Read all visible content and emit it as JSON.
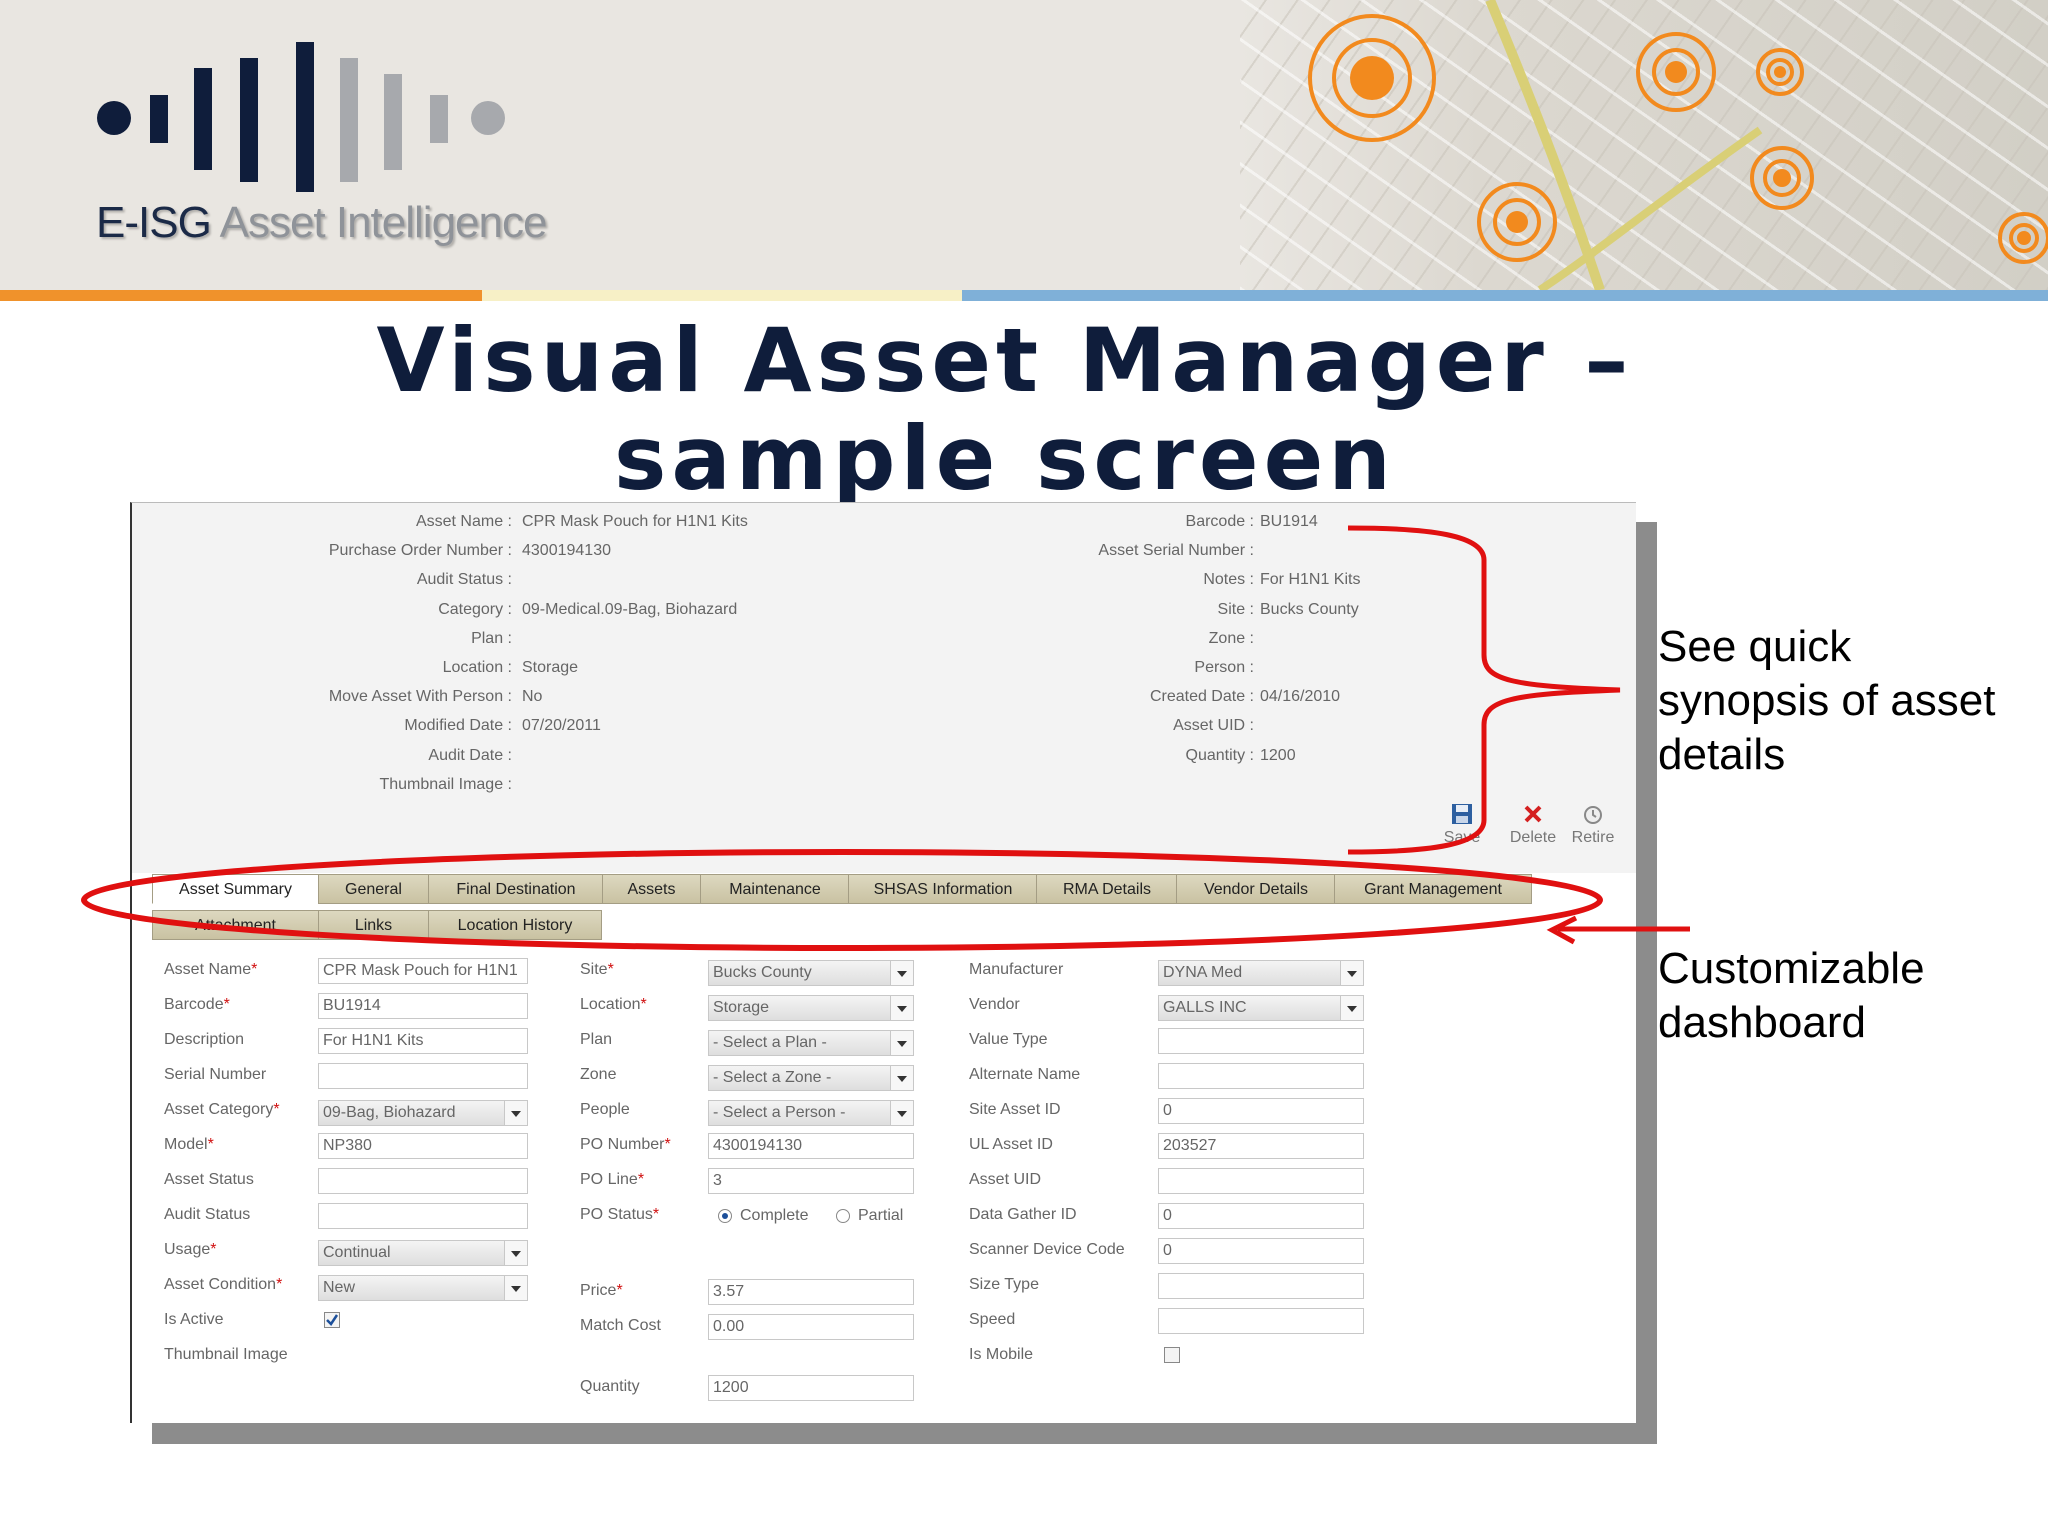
{
  "banner": {
    "logo_dark": "E-ISG",
    "logo_light": " Asset Intelligence"
  },
  "slide_title": "Visual Asset Manager – sample screen",
  "summary": {
    "left": [
      {
        "label": "Asset Name :",
        "value": "CPR Mask Pouch for H1N1 Kits"
      },
      {
        "label": "Purchase Order Number :",
        "value": "4300194130"
      },
      {
        "label": "Audit Status :",
        "value": ""
      },
      {
        "label": "Category :",
        "value": "09-Medical.09-Bag, Biohazard"
      },
      {
        "label": "Plan :",
        "value": ""
      },
      {
        "label": "Location :",
        "value": "Storage"
      },
      {
        "label": "Move Asset With Person :",
        "value": "No"
      },
      {
        "label": "Modified Date :",
        "value": "07/20/2011"
      },
      {
        "label": "Audit Date :",
        "value": ""
      },
      {
        "label": "Thumbnail Image :",
        "value": ""
      }
    ],
    "right": [
      {
        "label": "Barcode :",
        "value": "BU1914"
      },
      {
        "label": "Asset Serial Number :",
        "value": ""
      },
      {
        "label": "Notes :",
        "value": "For H1N1 Kits"
      },
      {
        "label": "Site :",
        "value": "Bucks County"
      },
      {
        "label": "Zone :",
        "value": ""
      },
      {
        "label": "Person :",
        "value": ""
      },
      {
        "label": "Created Date :",
        "value": "04/16/2010"
      },
      {
        "label": "Asset UID :",
        "value": ""
      },
      {
        "label": "Quantity :",
        "value": "1200"
      }
    ]
  },
  "toolbar": {
    "save_label": "Save",
    "delete_label": "Delete",
    "retire_label": "Retire"
  },
  "tabs_row1": [
    "Asset Summary",
    "General",
    "Final Destination",
    "Assets",
    "Maintenance",
    "SHSAS Information",
    "RMA Details",
    "Vendor Details",
    "Grant Management"
  ],
  "tabs_row2": [
    "Attachment",
    "Links",
    "Location History"
  ],
  "form": {
    "col1": [
      {
        "label": "Asset Name",
        "req": true,
        "type": "text",
        "value": "CPR Mask Pouch for H1N1"
      },
      {
        "label": "Barcode",
        "req": true,
        "type": "text",
        "value": "BU1914"
      },
      {
        "label": "Description",
        "req": false,
        "type": "text",
        "value": "For H1N1 Kits"
      },
      {
        "label": "Serial Number",
        "req": false,
        "type": "text",
        "value": ""
      },
      {
        "label": "Asset Category",
        "req": true,
        "type": "select",
        "value": "09-Bag, Biohazard"
      },
      {
        "label": "Model",
        "req": true,
        "type": "text",
        "value": "NP380"
      },
      {
        "label": "Asset Status",
        "req": false,
        "type": "text",
        "value": ""
      },
      {
        "label": "Audit Status",
        "req": false,
        "type": "text",
        "value": ""
      },
      {
        "label": "Usage",
        "req": true,
        "type": "select",
        "value": "Continual"
      },
      {
        "label": "Asset Condition",
        "req": true,
        "type": "select",
        "value": "New"
      },
      {
        "label": "Is Active",
        "req": false,
        "type": "checkbox",
        "checked": true
      },
      {
        "label": "Thumbnail Image",
        "req": false,
        "type": "none"
      }
    ],
    "col2": [
      {
        "label": "Site",
        "req": true,
        "type": "select",
        "value": "Bucks County"
      },
      {
        "label": "Location",
        "req": true,
        "type": "select",
        "value": "Storage"
      },
      {
        "label": "Plan",
        "req": false,
        "type": "select",
        "value": "- Select a Plan -"
      },
      {
        "label": "Zone",
        "req": false,
        "type": "select",
        "value": "- Select a Zone -"
      },
      {
        "label": "People",
        "req": false,
        "type": "select",
        "value": "- Select a Person -"
      },
      {
        "label": "PO Number",
        "req": true,
        "type": "text",
        "value": "4300194130"
      },
      {
        "label": "PO Line",
        "req": true,
        "type": "text",
        "value": "3"
      },
      {
        "label": "PO Status",
        "req": true,
        "type": "radio",
        "options": [
          "Complete",
          "Partial"
        ],
        "selected": "Complete"
      },
      {
        "label": "Price",
        "req": true,
        "type": "text",
        "value": "3.57"
      },
      {
        "label": "Match Cost",
        "req": false,
        "type": "text",
        "value": "0.00"
      },
      {
        "label": "Quantity",
        "req": false,
        "type": "text",
        "value": "1200"
      }
    ],
    "col3": [
      {
        "label": "Manufacturer",
        "req": false,
        "type": "select",
        "value": "DYNA Med"
      },
      {
        "label": "Vendor",
        "req": false,
        "type": "select",
        "value": "GALLS INC"
      },
      {
        "label": "Value Type",
        "req": false,
        "type": "text",
        "value": ""
      },
      {
        "label": "Alternate Name",
        "req": false,
        "type": "text",
        "value": ""
      },
      {
        "label": "Site Asset ID",
        "req": false,
        "type": "text",
        "value": "0"
      },
      {
        "label": "UL Asset ID",
        "req": false,
        "type": "text",
        "value": "203527"
      },
      {
        "label": "Asset UID",
        "req": false,
        "type": "text",
        "value": ""
      },
      {
        "label": "Data Gather ID",
        "req": false,
        "type": "text",
        "value": "0"
      },
      {
        "label": "Scanner Device Code",
        "req": false,
        "type": "text",
        "value": "0"
      },
      {
        "label": "Size Type",
        "req": false,
        "type": "text",
        "value": ""
      },
      {
        "label": "Speed",
        "req": false,
        "type": "text",
        "value": ""
      },
      {
        "label": "Is Mobile",
        "req": false,
        "type": "checkbox",
        "checked": false
      }
    ]
  },
  "annotations": {
    "synopsis": "See quick synopsis of asset details",
    "dashboard": "Customizable dashboard"
  },
  "colors": {
    "accent_red": "#e01010",
    "orange": "#f0922b",
    "navy": "#0f1d3b",
    "blue": "#7fb0d8"
  }
}
